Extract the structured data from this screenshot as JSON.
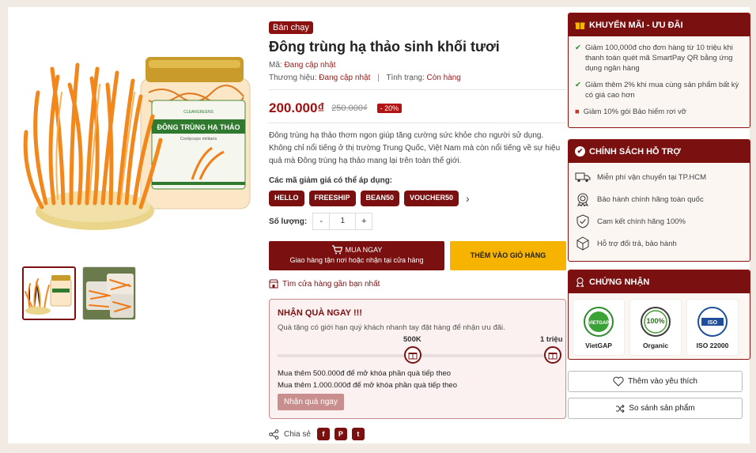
{
  "gallery": {
    "main_alt": "Đông trùng hạ thảo sinh khối tươi",
    "jar_label": "ĐÔNG TRÙNG HẠ THẢO",
    "jar_sub": "Cordyceps militaris",
    "jar_brand": "CLEANGREENS"
  },
  "product": {
    "badge": "Bán chạy",
    "title": "Đông trùng hạ thảo sinh khối tươi",
    "code_label": "Mã:",
    "code_value": "Đang cập nhật",
    "brand_label": "Thương hiệu:",
    "brand_value": "Đang cập nhật",
    "separator": "|",
    "status_label": "Tình trạng:",
    "status_value": "Còn hàng",
    "price": "200.000₫",
    "old_price": "250.000₫",
    "discount": "- 20%",
    "description": "Đông trùng hạ thảo thơm ngon giúp tăng cường sức khỏe cho người sử dụng. Không chỉ nổi tiếng ở thị trường Trung Quốc, Việt Nam mà còn nổi tiếng về sự hiệu quả mà Đông trùng hạ thảo mang lại trên toàn thế giới.",
    "coupon_title": "Các mã giảm giá có thể áp dụng:",
    "coupons": [
      "HELLO",
      "FREESHIP",
      "BEAN50",
      "VOUCHER50"
    ],
    "qty_label": "Số lượng:",
    "qty_minus": "-",
    "qty_value": "1",
    "qty_plus": "+",
    "buy_now": "MUA NGAY",
    "buy_now_sub": "Giao hàng tận nơi hoặc nhận tại cửa hàng",
    "add_to_cart": "THÊM VÀO GIỎ HÀNG",
    "find_store": "Tìm cửa hàng gần bạn nhất"
  },
  "gift": {
    "title": "NHẬN QUÀ NGAY !!!",
    "subtitle": "Quà tặng có giới hạn quý khách nhanh tay đặt hàng để nhận ưu đãi.",
    "milestone1": "500K",
    "milestone2": "1 triệu",
    "line1": "Mua thêm 500.000đ để mở khóa phần quà tiếp theo",
    "line2": "Mua thêm 1.000.000đ để mở khóa phần quà tiếp theo",
    "button": "Nhận quà ngay"
  },
  "share": {
    "label": "Chia sẻ",
    "facebook": "f",
    "pinterest": "P",
    "twitter": "t"
  },
  "promo": {
    "title": "KHUYẾN MÃI - ƯU ĐÃI",
    "items": [
      "Giảm 100,000đ cho đơn hàng từ 10 triệu khi thanh toán quét mã SmartPay QR bằng ứng dụng ngân hàng",
      "Giảm thêm 2% khi mua cùng sản phẩm bất kỳ có giá cao hơn",
      "Giảm 10% gói Bảo hiểm rơi vỡ"
    ]
  },
  "policy": {
    "title": "CHÍNH SÁCH HỖ TRỢ",
    "items": [
      "Miễn phí vận chuyển tại TP.HCM",
      "Bảo hành chính hãng toàn quốc",
      "Cam kết chính hãng 100%",
      "Hỗ trợ đổi trả, bảo hành"
    ]
  },
  "certs": {
    "title": "CHỨNG NHẬN",
    "items": [
      "VietGAP",
      "Organic",
      "ISO 22000"
    ],
    "logo_texts": [
      "VIETGAP",
      "100%",
      "ISO"
    ]
  },
  "wishlist": "Thêm vào yêu thích",
  "compare": "So sánh sản phẩm",
  "colors": {
    "brand": "#7a1010",
    "accent": "#f6b400",
    "price": "#a01010"
  }
}
